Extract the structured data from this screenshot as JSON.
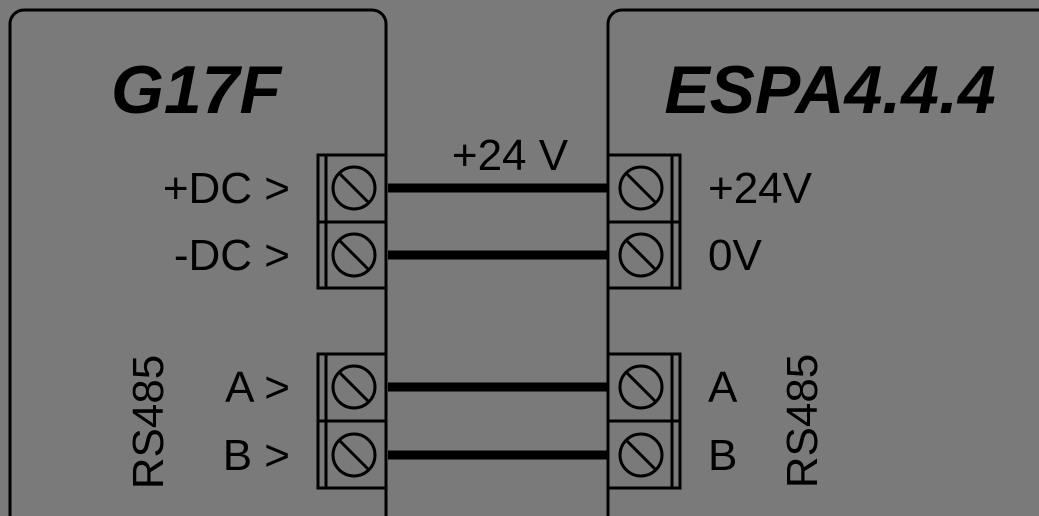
{
  "left_device": {
    "name": "G17F",
    "dc_plus_label": "+DC >",
    "dc_minus_label": "-DC >",
    "bus_label": "RS485",
    "a_label": "A >",
    "b_label": "B >"
  },
  "right_device": {
    "name": "ESPA4.4.4",
    "plus_label": "+24V",
    "zero_label": "0V",
    "bus_label": "RS485",
    "a_label": "A",
    "b_label": "B"
  },
  "wire_label": "+24 V",
  "colors": {
    "background": "#7a7a7a",
    "lines": "#000000"
  }
}
